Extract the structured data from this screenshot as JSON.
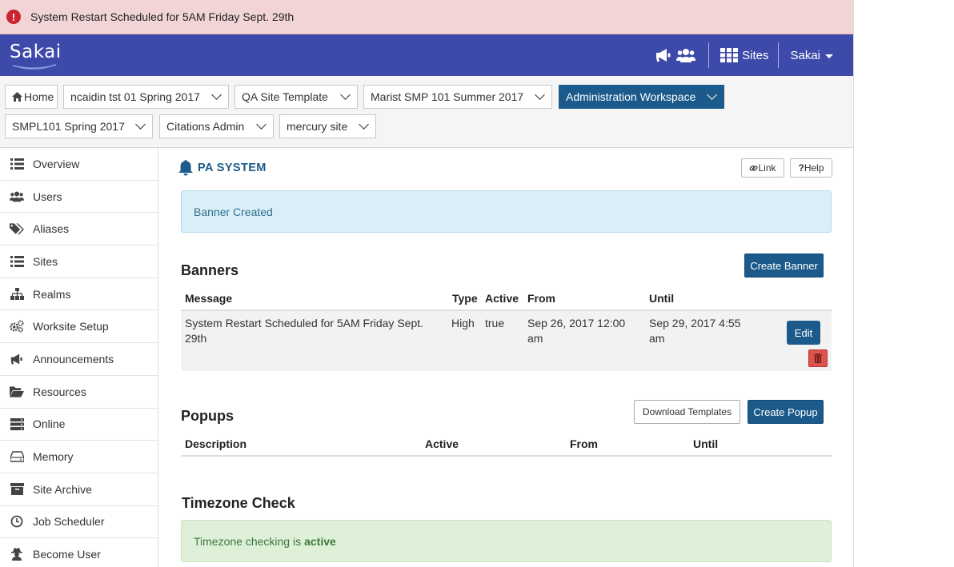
{
  "alert": {
    "message": "System Restart Scheduled for 5AM Friday Sept. 29th",
    "icon": "exclamation-circle-icon"
  },
  "header": {
    "logo_text": "Sakai",
    "sites_label": "Sites",
    "user_label": "Sakai",
    "brand_color": "#3d4aa9"
  },
  "site_tabs": {
    "home": "Home",
    "row1": [
      "ncaidin tst 01 Spring 2017",
      "QA Site Template",
      "Marist SMP 101 Summer 2017",
      "Administration Workspace"
    ],
    "row2": [
      "SMPL101 Spring 2017",
      "Citations Admin",
      "mercury site"
    ],
    "active": "Administration Workspace"
  },
  "sidebar": {
    "items": [
      {
        "label": "Overview",
        "icon": "list-icon"
      },
      {
        "label": "Users",
        "icon": "users-icon"
      },
      {
        "label": "Aliases",
        "icon": "tags-icon"
      },
      {
        "label": "Sites",
        "icon": "list-icon"
      },
      {
        "label": "Realms",
        "icon": "sitemap-icon"
      },
      {
        "label": "Worksite Setup",
        "icon": "gears-icon"
      },
      {
        "label": "Announcements",
        "icon": "bullhorn-icon"
      },
      {
        "label": "Resources",
        "icon": "folder-open-icon"
      },
      {
        "label": "Online",
        "icon": "server-icon"
      },
      {
        "label": "Memory",
        "icon": "hdd-icon"
      },
      {
        "label": "Site Archive",
        "icon": "archive-icon"
      },
      {
        "label": "Job Scheduler",
        "icon": "clock-icon"
      },
      {
        "label": "Become User",
        "icon": "user-secret-icon"
      }
    ]
  },
  "tool": {
    "title": "PA SYSTEM",
    "link_label": "Link",
    "help_label": "Help",
    "info_message": "Banner Created"
  },
  "banners": {
    "title": "Banners",
    "create_label": "Create Banner",
    "columns": [
      "Message",
      "Type",
      "Active",
      "From",
      "Until"
    ],
    "rows": [
      {
        "message_line1": "System Restart Scheduled for 5AM Friday Sept.",
        "message_line2": "29th",
        "type": "High",
        "active": "true",
        "from_line1": "Sep 26, 2017 12:00",
        "from_line2": "am",
        "until_line1": "Sep 29, 2017 4:55",
        "until_line2": "am",
        "edit_label": "Edit"
      }
    ]
  },
  "popups": {
    "title": "Popups",
    "download_label": "Download Templates",
    "create_label": "Create Popup",
    "columns": [
      "Description",
      "Active",
      "From",
      "Until"
    ]
  },
  "timezone": {
    "title": "Timezone Check",
    "message": "Timezone checking is",
    "status": "active"
  }
}
